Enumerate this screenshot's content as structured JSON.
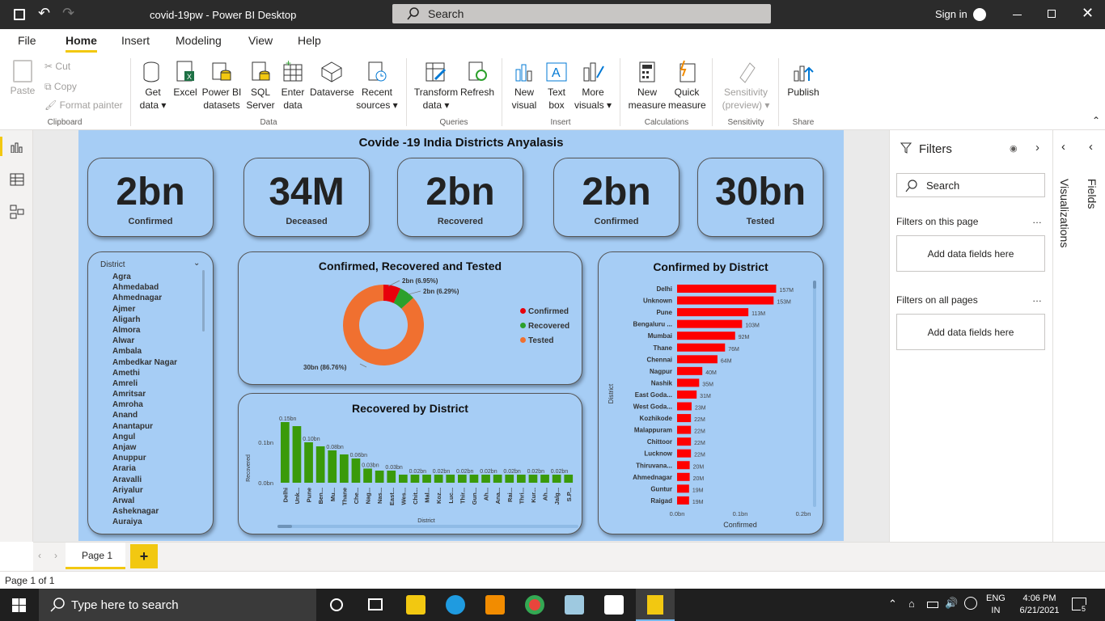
{
  "window": {
    "title": "covid-19pw - Power BI Desktop",
    "search_placeholder": "Search",
    "sign_in": "Sign in"
  },
  "menu": [
    "File",
    "Home",
    "Insert",
    "Modeling",
    "View",
    "Help"
  ],
  "ribbon": {
    "clipboard": {
      "paste": "Paste",
      "cut": "Cut",
      "copy": "Copy",
      "format_painter": "Format painter",
      "group": "Clipboard"
    },
    "data": {
      "get_data": "Get data",
      "excel": "Excel",
      "pbi_datasets": "Power BI datasets",
      "sql": "SQL Server",
      "enter_data": "Enter data",
      "dataverse": "Dataverse",
      "recent": "Recent sources",
      "group": "Data"
    },
    "queries": {
      "transform": "Transform data",
      "refresh": "Refresh",
      "group": "Queries"
    },
    "insert": {
      "new_visual": "New visual",
      "text_box": "Text box",
      "more_visuals": "More visuals",
      "group": "Insert"
    },
    "calculations": {
      "new_measure": "New measure",
      "quick_measure": "Quick measure",
      "group": "Calculations"
    },
    "sensitivity": {
      "label": "Sensitivity (preview)",
      "group": "Sensitivity"
    },
    "share": {
      "publish": "Publish",
      "group": "Share"
    }
  },
  "report": {
    "title": "Covide -19 India Districts Anyalasis",
    "kpis": [
      {
        "value": "2bn",
        "label": "Confirmed"
      },
      {
        "value": "34M",
        "label": "Deceased"
      },
      {
        "value": "2bn",
        "label": "Recovered"
      },
      {
        "value": "2bn",
        "label": "Confirmed"
      },
      {
        "value": "30bn",
        "label": "Tested"
      }
    ],
    "slicer": {
      "header": "District",
      "items": [
        "Agra",
        "Ahmedabad",
        "Ahmednagar",
        "Ajmer",
        "Aligarh",
        "Almora",
        "Alwar",
        "Ambala",
        "Ambedkar Nagar",
        "Amethi",
        "Amreli",
        "Amritsar",
        "Amroha",
        "Anand",
        "Anantapur",
        "Angul",
        "Anjaw",
        "Anuppur",
        "Araria",
        "Aravalli",
        "Ariyalur",
        "Arwal",
        "Asheknagar",
        "Auraiya"
      ]
    }
  },
  "chart_data": [
    {
      "type": "pie",
      "title": "Confirmed, Recovered and Tested",
      "categories": [
        "Confirmed",
        "Recovered",
        "Tested"
      ],
      "values": [
        6.95,
        6.29,
        86.76
      ],
      "data_labels": [
        "2bn (6.95%)",
        "2bn (6.29%)",
        "30bn (86.76%)"
      ],
      "colors": [
        "#e8000b",
        "#2ca02c",
        "#f07030"
      ],
      "legend": "right"
    },
    {
      "type": "bar",
      "title": "Recovered by District",
      "xlabel": "District",
      "ylabel": "Recovered",
      "categories": [
        "Delhi",
        "Unk...",
        "Pune",
        "Ben...",
        "Mu...",
        "Thane",
        "Che...",
        "Nag...",
        "Nas...",
        "East...",
        "Wes...",
        "Chit...",
        "Mal...",
        "Koz...",
        "Luc...",
        "Thir...",
        "Gun...",
        "Ah...",
        "Ana...",
        "Rai...",
        "Thri...",
        "Kur...",
        "Ah...",
        "Jalg...",
        "S.P..."
      ],
      "values": [
        0.15,
        0.14,
        0.1,
        0.09,
        0.08,
        0.07,
        0.06,
        0.035,
        0.03,
        0.03,
        0.02,
        0.02,
        0.02,
        0.02,
        0.02,
        0.02,
        0.02,
        0.02,
        0.02,
        0.02,
        0.02,
        0.02,
        0.02,
        0.02,
        0.02
      ],
      "data_labels": [
        "0.15bn",
        "",
        "0.10bn",
        "",
        "0.08bn",
        "",
        "0.06bn",
        "0.03bn",
        "",
        "0.03bn",
        "",
        "0.02bn",
        "",
        "0.02bn",
        "",
        "0.02bn",
        "",
        "0.02bn",
        "",
        "0.02bn",
        "",
        "0.02bn",
        "",
        "0.02bn",
        ""
      ],
      "ytick_labels": [
        "0.0bn",
        "0.1bn"
      ],
      "ylim": [
        0,
        0.16
      ],
      "color": "#3a9a0a"
    },
    {
      "type": "bar",
      "orientation": "horizontal",
      "title": "Confirmed by District",
      "xlabel": "Confirmed",
      "ylabel": "District",
      "categories": [
        "Delhi",
        "Unknown",
        "Pune",
        "Bengaluru ...",
        "Mumbai",
        "Thane",
        "Chennai",
        "Nagpur",
        "Nashik",
        "East Goda...",
        "West Goda...",
        "Kozhikode",
        "Malappuram",
        "Chittoor",
        "Lucknow",
        "Thiruvana...",
        "Ahmednagar",
        "Guntur",
        "Raigad"
      ],
      "values": [
        157,
        153,
        113,
        103,
        92,
        76,
        64,
        40,
        35,
        31,
        23,
        22,
        22,
        22,
        22,
        20,
        20,
        19,
        19
      ],
      "data_labels": [
        "157M",
        "153M",
        "113M",
        "103M",
        "92M",
        "76M",
        "64M",
        "40M",
        "35M",
        "31M",
        "23M",
        "22M",
        "22M",
        "22M",
        "22M",
        "20M",
        "20M",
        "19M",
        "19M"
      ],
      "xtick_labels": [
        "0.0bn",
        "0.1bn",
        "0.2bn"
      ],
      "xlim": [
        0,
        200
      ],
      "color": "#ff0000"
    }
  ],
  "filters": {
    "title": "Filters",
    "search": "Search",
    "on_page": "Filters on this page",
    "on_all": "Filters on all pages",
    "add_fields": "Add data fields here"
  },
  "side_tabs": {
    "visualizations": "Visualizations",
    "fields": "Fields"
  },
  "pages": {
    "tab": "Page 1",
    "add": "+",
    "status": "Page 1 of 1"
  },
  "taskbar": {
    "search": "Type here to search",
    "lang1": "ENG",
    "lang2": "IN",
    "time": "4:06 PM",
    "date": "6/21/2021",
    "notif": "5"
  }
}
